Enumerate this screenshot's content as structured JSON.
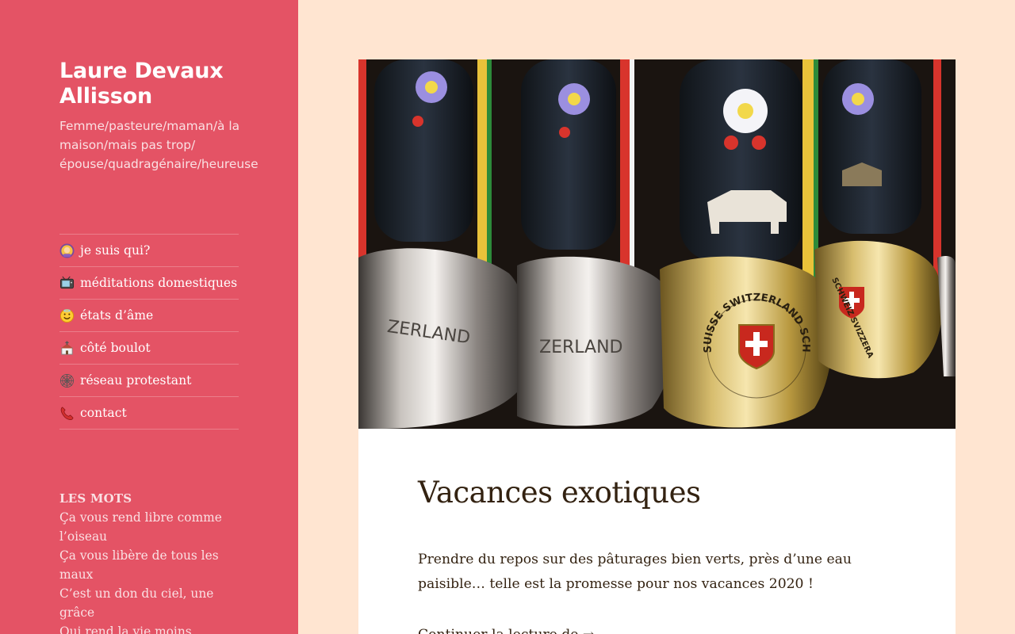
{
  "site": {
    "title": "Laure Devaux Allisson",
    "description": "Femme/pasteure/maman/à la maison/mais pas trop/ épouse/quadragénaire/heureuse"
  },
  "menu": [
    {
      "label": "je suis qui?",
      "icon": "person-icon"
    },
    {
      "label": "méditations domestiques",
      "icon": "television-icon"
    },
    {
      "label": "états d’âme",
      "icon": "smiling-face-icon"
    },
    {
      "label": "côté boulot",
      "icon": "church-icon"
    },
    {
      "label": "réseau protestant",
      "icon": "spider-web-icon"
    },
    {
      "label": "contact",
      "icon": "telephone-icon"
    }
  ],
  "widget": {
    "title": "LES MOTS",
    "lines": [
      "Ça vous rend libre comme l’oiseau",
      "Ça vous libère de tous les maux",
      "C’est un don du ciel, une grâce",
      "Qui rend la vie moins"
    ]
  },
  "post": {
    "title": "Vacances exotiques",
    "excerpt": "Prendre du repos sur des pâturages bien verts, près d’une eau paisible… telle est la promesse pour nos vacances 2020 !",
    "read_more": "Continuer la lecture de →",
    "image_text": [
      "ZERLAND",
      "ZERLAND",
      "SUISSE SWITZERLAND SCHWEIZ SVIZZERA",
      "SCHWEIZ SVIZZERA"
    ]
  },
  "colors": {
    "sidebar": "#e45365",
    "page_background": "#ffe5d1",
    "text": "#332211"
  }
}
